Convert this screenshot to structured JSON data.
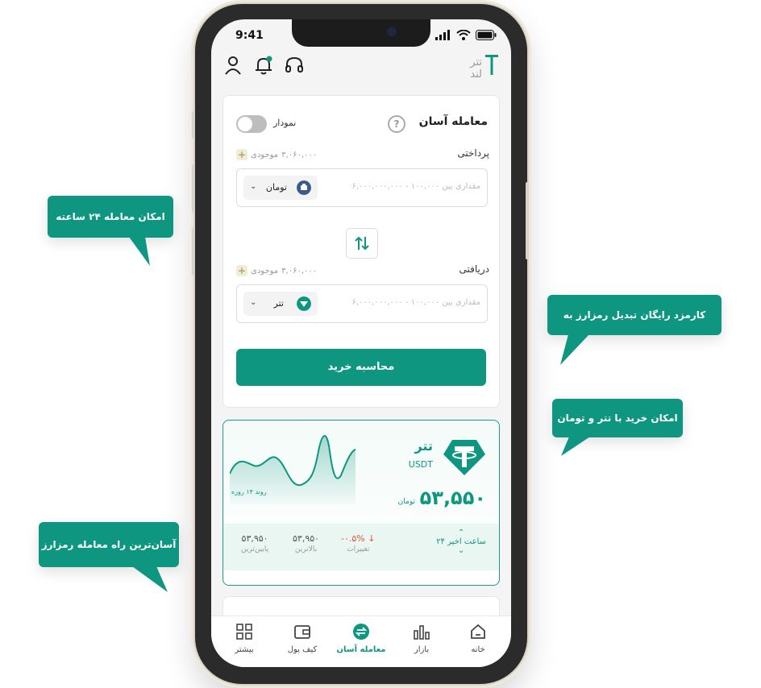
{
  "status": {
    "time": "9:41"
  },
  "brand": {
    "logo_text_top": "تتر",
    "logo_text_bottom": "لند"
  },
  "trade": {
    "title": "معامله آسان",
    "help": "?",
    "chart_toggle_label": "نمودار",
    "pay_label": "پرداختی",
    "pay_balance_label": "موجودی",
    "pay_balance": "۳,۰۶۰,۰۰۰",
    "pay_placeholder": "مقداری بین ۱۰۰,۰۰۰ - ۶,۰۰۰,۰۰۰,۰۰۰",
    "pay_coin": "تومان",
    "receive_label": "دریافتی",
    "receive_balance_label": "موجودی",
    "receive_balance": "۳,۰۶۰,۰۰۰",
    "receive_placeholder": "مقداری بین ۱۰۰,۰۰۰ - ۶,۰۰۰,۰۰۰,۰۰۰",
    "receive_coin": "تتر",
    "calc_button": "محاسبه خرید"
  },
  "tether_card": {
    "name": "تتر",
    "symbol": "USDT",
    "price": "۵۳,۵۵۰",
    "unit": "تومان",
    "trend_label": "روند ۱۴ روزه",
    "period": "۲۴ ساعت اخیر",
    "change_value": "-۰.۵%",
    "change_label": "تغییرات",
    "high_value": "۵۳,۹۵۰",
    "high_label": "بالاترین",
    "low_value": "۵۳,۹۵۰",
    "low_label": "پایین‌ترین"
  },
  "nav": [
    {
      "label": "خانه",
      "icon": "home-icon"
    },
    {
      "label": "بازار",
      "icon": "market-chart-icon"
    },
    {
      "label": "معامله آسان",
      "icon": "swap-circle-icon"
    },
    {
      "label": "کیف پول",
      "icon": "wallet-icon"
    },
    {
      "label": "بیشتر",
      "icon": "grid-icon"
    }
  ],
  "tooltips": {
    "t1": "امکان معامله ۲۴ ساعته",
    "t2": "کارمزد رایگان تبدیل رمزارز به رمزارز",
    "t3": "امکان خرید با تتر و تومان",
    "t4": "آسان‌ترین راه معامله رمزارز"
  },
  "colors": {
    "accent": "#0e9680",
    "danger": "#e05a3a"
  }
}
